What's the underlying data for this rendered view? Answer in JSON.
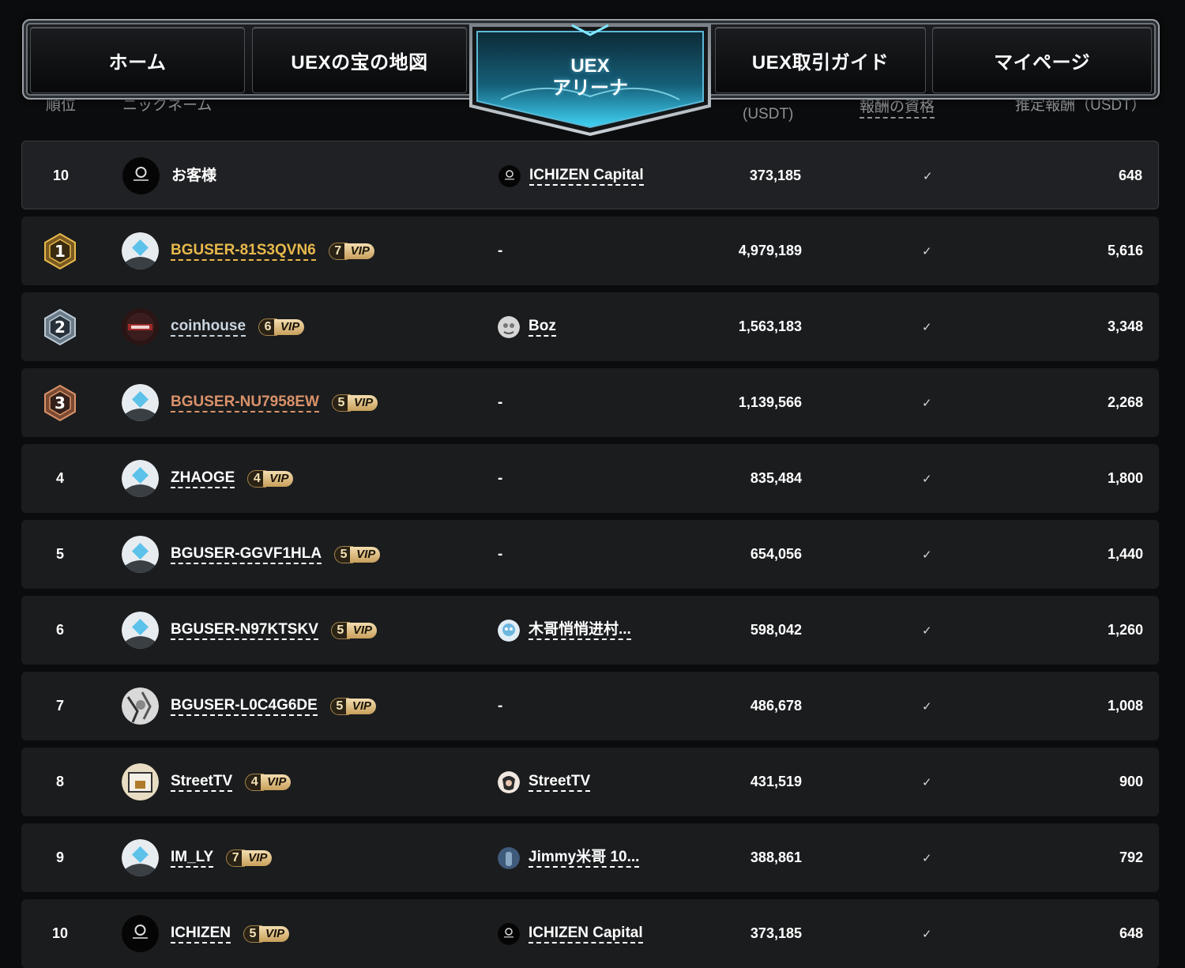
{
  "nav": {
    "tabs": [
      {
        "label": "ホーム"
      },
      {
        "label": "UEXの宝の地図"
      },
      {
        "label": "UEX\nアリーナ"
      },
      {
        "label": "UEX取引ガイド"
      },
      {
        "label": "マイページ"
      }
    ],
    "active_tab": "UEX アリーナ"
  },
  "table": {
    "headers": {
      "rank": "順位",
      "nickname": "ニックネーム",
      "volume": "(USDT)",
      "eligibility": "報酬の資格",
      "reward": "推定報酬（USDT）"
    },
    "my_row": {
      "rank": "10",
      "name": "お客様",
      "team": "ICHIZEN Capital",
      "volume": "373,185",
      "eligible": "✓",
      "reward": "648",
      "avatar": "ichizen-logo"
    },
    "rows": [
      {
        "rank": "1",
        "medal": "gold",
        "name": "BGUSER-81S3QVN6",
        "name_color": "#e7b94b",
        "vip": "7",
        "vip_label": "VIP",
        "team": "-",
        "volume": "4,979,189",
        "eligible": "✓",
        "reward": "5,616",
        "avatar": "default-diamond"
      },
      {
        "rank": "2",
        "medal": "silver",
        "name": "coinhouse",
        "name_color": "#c9d4de",
        "vip": "6",
        "vip_label": "VIP",
        "team": "Boz",
        "volume": "1,563,183",
        "eligible": "✓",
        "reward": "3,348",
        "avatar": "coinhouse-logo"
      },
      {
        "rank": "3",
        "medal": "bronze",
        "name": "BGUSER-NU7958EW",
        "name_color": "#d9926a",
        "vip": "5",
        "vip_label": "VIP",
        "team": "-",
        "volume": "1,139,566",
        "eligible": "✓",
        "reward": "2,268",
        "avatar": "default-diamond"
      },
      {
        "rank": "4",
        "name": "ZHAOGE",
        "vip": "4",
        "vip_label": "VIP",
        "team": "-",
        "volume": "835,484",
        "eligible": "✓",
        "reward": "1,800",
        "avatar": "default-diamond"
      },
      {
        "rank": "5",
        "name": "BGUSER-GGVF1HLA",
        "vip": "5",
        "vip_label": "VIP",
        "team": "-",
        "volume": "654,056",
        "eligible": "✓",
        "reward": "1,440",
        "avatar": "default-diamond"
      },
      {
        "rank": "6",
        "name": "BGUSER-N97KTSKV",
        "vip": "5",
        "vip_label": "VIP",
        "team": "木哥悄悄进村...",
        "volume": "598,042",
        "eligible": "✓",
        "reward": "1,260",
        "avatar": "default-diamond"
      },
      {
        "rank": "7",
        "name": "BGUSER-L0C4G6DE",
        "vip": "5",
        "vip_label": "VIP",
        "team": "-",
        "volume": "486,678",
        "eligible": "✓",
        "reward": "1,008",
        "avatar": "sketch-photo"
      },
      {
        "rank": "8",
        "name": "StreetTV",
        "vip": "4",
        "vip_label": "VIP",
        "team": "StreetTV",
        "volume": "431,519",
        "eligible": "✓",
        "reward": "900",
        "avatar": "streettv-logo"
      },
      {
        "rank": "9",
        "name": "IM_LY",
        "vip": "7",
        "vip_label": "VIP",
        "team": "Jimmy米哥 10...",
        "volume": "388,861",
        "eligible": "✓",
        "reward": "792",
        "avatar": "default-diamond"
      },
      {
        "rank": "10",
        "name": "ICHIZEN",
        "vip": "5",
        "vip_label": "VIP",
        "team": "ICHIZEN Capital",
        "volume": "373,185",
        "eligible": "✓",
        "reward": "648",
        "avatar": "ichizen-logo"
      }
    ]
  },
  "colors": {
    "gold": "#e7b94b",
    "silver": "#c9d4de",
    "bronze": "#d9926a",
    "accent_cyan": "#39c6ef",
    "row_bg": "#1b1c1e"
  }
}
